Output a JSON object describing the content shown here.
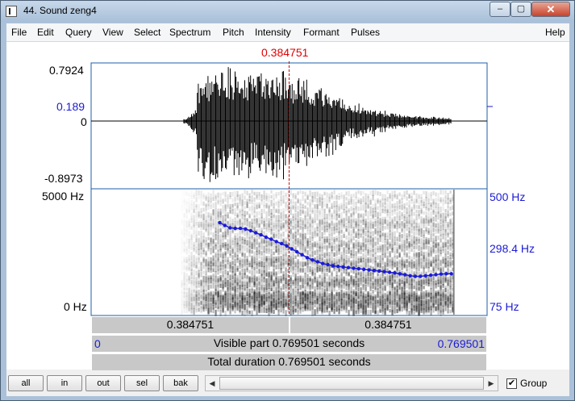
{
  "window": {
    "title": "44. Sound zeng4",
    "minimize": "‒",
    "maximize": "▢",
    "close": "✕"
  },
  "menu": [
    "File",
    "Edit",
    "Query",
    "View",
    "Select",
    "Spectrum",
    "Pitch",
    "Intensity",
    "Formant",
    "Pulses",
    "Help"
  ],
  "cursor": {
    "time_label": "0.384751",
    "time": 0.384751
  },
  "waveform": {
    "max_label": "0.7924",
    "marker_label": "0.189",
    "zero_label": "0",
    "min_label": "-0.8973"
  },
  "spectrogram": {
    "top_label": "5000 Hz",
    "bottom_label": "0 Hz"
  },
  "pitch_axis": {
    "top_label": "500 Hz",
    "mid_label": "298.4 Hz",
    "bottom_label": "75 Hz",
    "min_hz": 75,
    "max_hz": 500
  },
  "time_bars": {
    "left_segment": "0.384751",
    "right_segment": "0.384751",
    "visible_start": "0",
    "visible_text": "Visible part 0.769501 seconds",
    "visible_end": "0.769501",
    "total_text": "Total duration 0.769501 seconds"
  },
  "buttons": [
    "all",
    "in",
    "out",
    "sel",
    "bak"
  ],
  "group": {
    "label": "Group",
    "checked": true,
    "check_mark": "✔"
  },
  "scroll_arrows": {
    "left": "◀",
    "right": "▶"
  },
  "chart_data": {
    "type": "line",
    "x_unit": "s",
    "y_unit": "Hz",
    "duration": 0.769501,
    "x": [
      0.25,
      0.26,
      0.27,
      0.28,
      0.29,
      0.3,
      0.31,
      0.32,
      0.33,
      0.34,
      0.35,
      0.36,
      0.37,
      0.38,
      0.39,
      0.4,
      0.41,
      0.42,
      0.43,
      0.44,
      0.45,
      0.46,
      0.47,
      0.48,
      0.49,
      0.5,
      0.51,
      0.52,
      0.53,
      0.54,
      0.55,
      0.56,
      0.57,
      0.58,
      0.59,
      0.6,
      0.61,
      0.62,
      0.63,
      0.64,
      0.65,
      0.66,
      0.67,
      0.68,
      0.69,
      0.7
    ],
    "y": [
      390,
      380,
      372,
      370,
      370,
      368,
      362,
      355,
      348,
      340,
      333,
      325,
      318,
      310,
      300,
      290,
      280,
      270,
      262,
      256,
      250,
      246,
      242,
      240,
      238,
      236,
      234,
      232,
      230,
      228,
      226,
      224,
      222,
      220,
      218,
      215,
      212,
      208,
      206,
      206,
      208,
      210,
      212,
      214,
      215,
      215
    ]
  }
}
